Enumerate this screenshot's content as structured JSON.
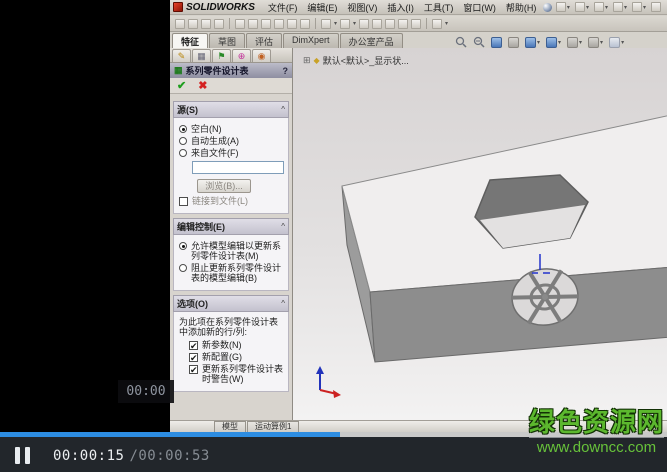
{
  "player": {
    "current_time": "00:00:15",
    "duration": "/00:00:53",
    "seek_tooltip": "00:00",
    "progress_percent": 51
  },
  "watermark": {
    "site_name": "绿色资源网",
    "site_url": "www.downcc.com",
    "green": "#5cb82e"
  },
  "colors": {
    "progress_blue": "#2d8de2",
    "ok_green": "#1e9e1e",
    "cancel_red": "#d42222"
  },
  "app": {
    "brand": "SOLIDWORKS",
    "menus": [
      "文件(F)",
      "编辑(E)",
      "视图(V)",
      "插入(I)",
      "工具(T)",
      "窗口(W)",
      "帮助(H)"
    ],
    "command_tabs": [
      "特征",
      "草图",
      "评估",
      "DimXpert",
      "办公室产品"
    ],
    "active_tab": "特征",
    "config_label": "默认<默认>_显示状...",
    "bottom_tabs": [
      "模型",
      "运动算例1"
    ]
  },
  "panel": {
    "tab_glyphs": [
      "✎",
      "▦",
      "⚑",
      "⊕",
      "◉"
    ],
    "title": "系列零件设计表",
    "help_glyph": "?",
    "ok_glyph": "✔",
    "cancel_glyph": "✖",
    "chevron_glyph": "^",
    "grid_glyph": "▦",
    "plusbox_glyph": "⊞",
    "part_glyph": "◆",
    "caret_glyph": "▾",
    "source": {
      "header": "源(S)",
      "radio_blank": "空白(N)",
      "radio_auto": "自动生成(A)",
      "radio_file": "来自文件(F)",
      "input_value": "",
      "browse_button": "浏览(B)...",
      "link_checkbox": "链接到文件(L)"
    },
    "edit_control": {
      "header": "编辑控制(E)",
      "radio_allow": "允许模型编辑以更新系列零件设计表(M)",
      "radio_block": "阻止更新系列零件设计表的模型编辑(B)"
    },
    "options": {
      "header": "选项(O)",
      "description": "为此项在系列零件设计表中添加新的行/列:",
      "check_new_params": "新参数(N)",
      "check_new_configs": "新配置(G)",
      "check_warn": "更新系列零件设计表时警告(W)",
      "check_glyph": "✔"
    }
  }
}
